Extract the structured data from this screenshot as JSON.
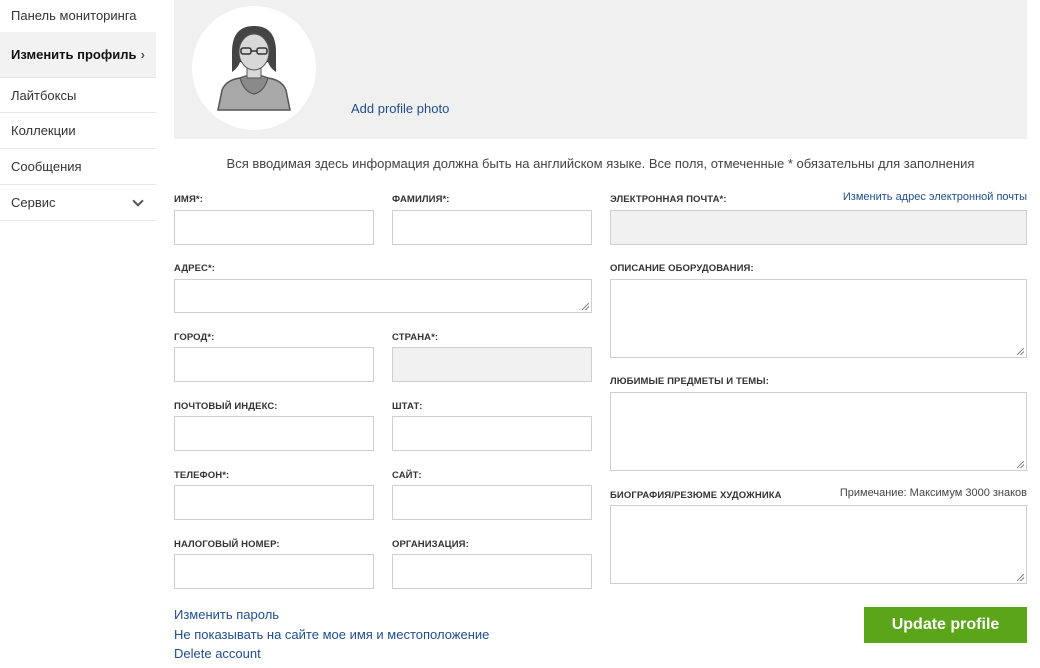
{
  "sidebar": {
    "items": [
      {
        "label": "Панель мониторинга"
      },
      {
        "label": "Изменить профиль"
      },
      {
        "label": "Лайтбоксы"
      },
      {
        "label": "Коллекции"
      },
      {
        "label": "Сообщения"
      },
      {
        "label": "Сервис"
      }
    ]
  },
  "photo": {
    "add_label": "Add profile photo"
  },
  "notice": "Вся вводимая здесь информация должна быть на английском языке. Все поля, отмеченные * обязательны для заполнения",
  "fields": {
    "first_name": "ИМЯ*:",
    "last_name": "ФАМИЛИЯ*:",
    "email": "ЭЛЕКТРОННАЯ ПОЧТА*:",
    "change_email": "Изменить адрес электронной почты",
    "address": "АДРЕС*:",
    "equipment": "ОПИСАНИЕ ОБОРУДОВАНИЯ:",
    "city": "ГОРОД*:",
    "country": "СТРАНА*:",
    "favorites": "ЛЮБИМЫЕ ПРЕДМЕТЫ И ТЕМЫ:",
    "zip": "ПОЧТОВЫЙ ИНДЕКС:",
    "state": "ШТАТ:",
    "phone": "ТЕЛЕФОН*:",
    "website": "САЙТ:",
    "bio": "БИОГРАФИЯ/РЕЗЮМЕ ХУДОЖНИКА",
    "bio_note": "Примечание: Максимум 3000 знаков",
    "tax": "НАЛОГОВЫЙ НОМЕР:",
    "org": "ОРГАНИЗАЦИЯ:"
  },
  "links": {
    "change_password": "Изменить пароль",
    "hide_name": "Не показывать на сайте мое имя и местоположение",
    "delete_account": "Delete account"
  },
  "update_label": "Update profile",
  "colors": {
    "accent_green": "#5aa618",
    "link_blue": "#1f4e8c"
  }
}
